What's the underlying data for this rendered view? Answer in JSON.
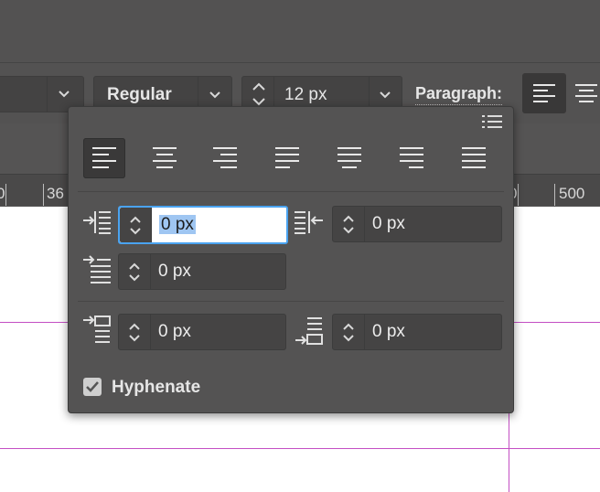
{
  "toolbar": {
    "font_style_value": "Regular",
    "font_size_value": "12 px",
    "paragraph_label": "Paragraph:"
  },
  "ruler": {
    "left_labels": [
      "0",
      "36"
    ],
    "right_labels": [
      "0",
      "500"
    ]
  },
  "popover": {
    "alignments": [
      {
        "name": "align-left",
        "active": true
      },
      {
        "name": "align-center",
        "active": false
      },
      {
        "name": "align-right",
        "active": false
      },
      {
        "name": "justify-left",
        "active": false
      },
      {
        "name": "justify-center",
        "active": false
      },
      {
        "name": "justify-right",
        "active": false
      },
      {
        "name": "justify-all",
        "active": false
      }
    ],
    "left_indent": "0 px",
    "right_indent": "0 px",
    "first_line_indent": "0 px",
    "space_before": "0 px",
    "space_after": "0 px",
    "hyphenate_label": "Hyphenate",
    "hyphenate_checked": true
  },
  "colors": {
    "panel": "#545353",
    "focus_ring": "#4aa3f0",
    "guide": "#c44fc4",
    "canvas": "#ffffff"
  },
  "icons": [
    "chevron-down-icon",
    "stepper-icon",
    "align-left-icon",
    "align-center-icon",
    "align-right-icon",
    "justify-left-icon",
    "justify-center-icon",
    "justify-right-icon",
    "justify-all-icon",
    "list-icon",
    "left-indent-icon",
    "right-indent-icon",
    "first-line-indent-icon",
    "space-before-icon",
    "space-after-icon",
    "checkmark-icon"
  ]
}
